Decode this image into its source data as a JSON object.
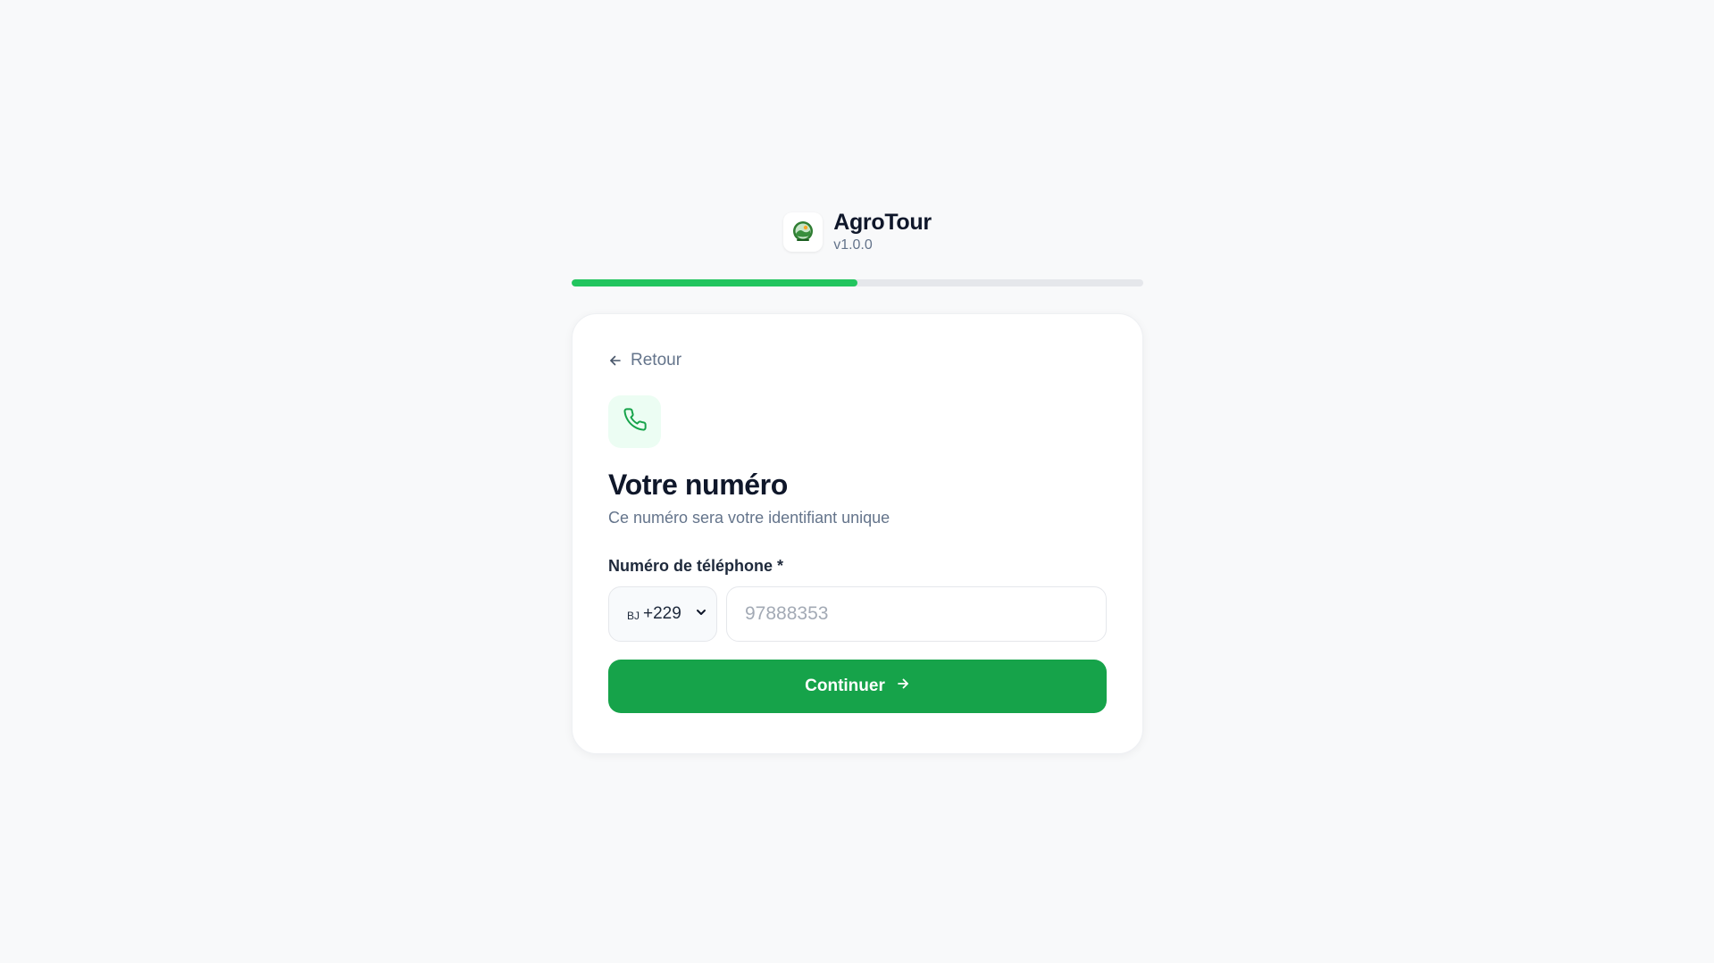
{
  "app": {
    "name": "AgroTour",
    "version": "v1.0.0",
    "logo_icon": "agrotour-logo-icon"
  },
  "progress": {
    "fraction": 0.5
  },
  "back": {
    "label": "Retour",
    "icon": "arrow-left-icon"
  },
  "step": {
    "icon": "phone-icon",
    "title": "Votre numéro",
    "subtitle": "Ce numéro sera votre identifiant unique"
  },
  "phone_field": {
    "label": "Numéro de téléphone *",
    "country_code": "BJ",
    "dial_code": "+229",
    "placeholder": "97888353",
    "value": ""
  },
  "submit": {
    "label": "Continuer",
    "icon": "arrow-right-icon"
  },
  "colors": {
    "accent": "#16a34a",
    "progress": "#22c55e",
    "badge_bg": "#ecfdf3"
  }
}
